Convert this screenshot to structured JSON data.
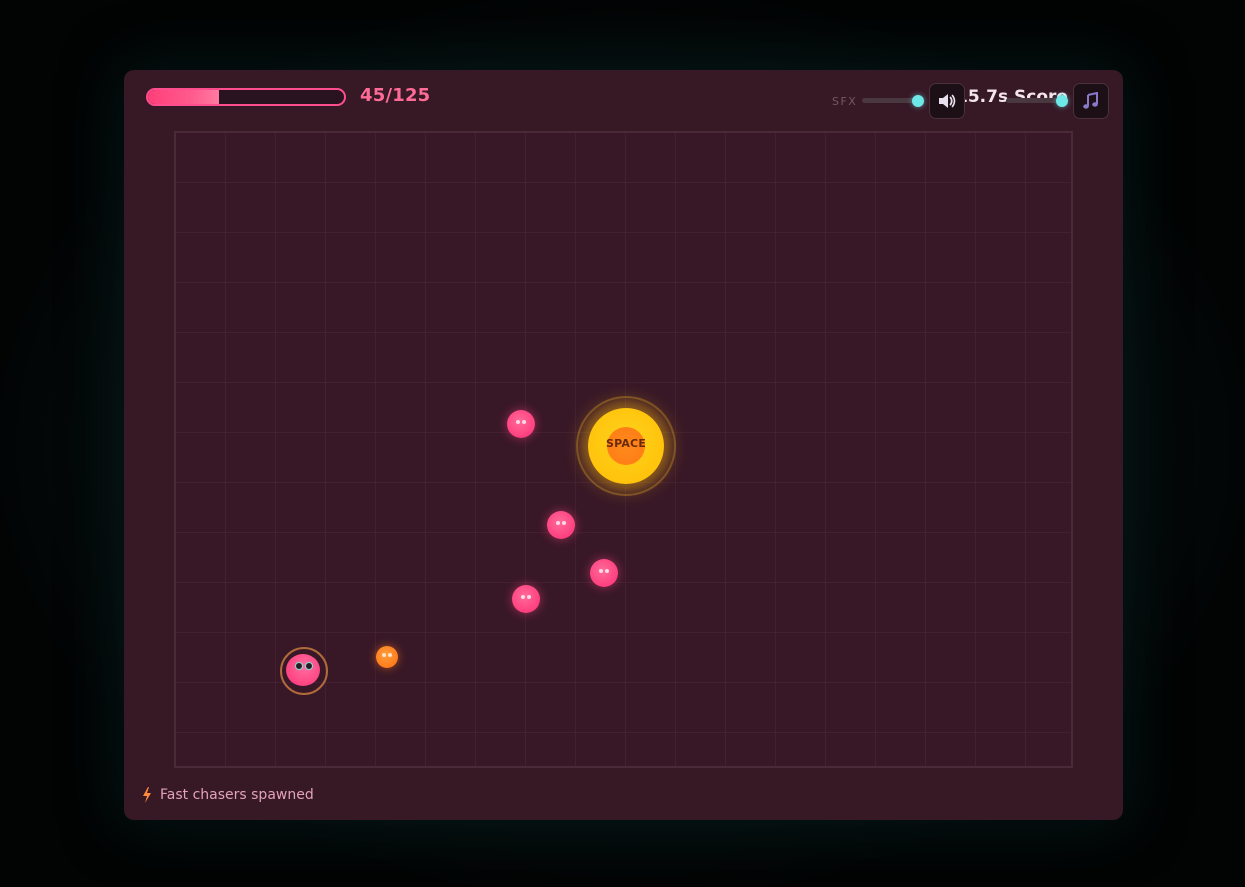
{
  "hud": {
    "health": {
      "current": 45,
      "max": 125,
      "label": "45/125",
      "fraction": 0.36
    },
    "timer": "15.7s",
    "score": "Score 151",
    "sfx": {
      "label": "SFX",
      "level": 1.0
    },
    "music": {
      "level": 1.0
    },
    "icons": {
      "sound": "speaker-icon",
      "music": "music-note-icon"
    }
  },
  "arena": {
    "powerup": {
      "label": "SPACE"
    }
  },
  "notification": {
    "icon": "lightning-icon",
    "text": "Fast chasers spawned"
  },
  "colors": {
    "accent": "#ff4d8d",
    "chaser": "#ff3f7f",
    "fast_chaser": "#ff7a1a",
    "powerup": "#ffc10a",
    "slider_knob": "#6ee7e7",
    "panel": "#371825"
  }
}
